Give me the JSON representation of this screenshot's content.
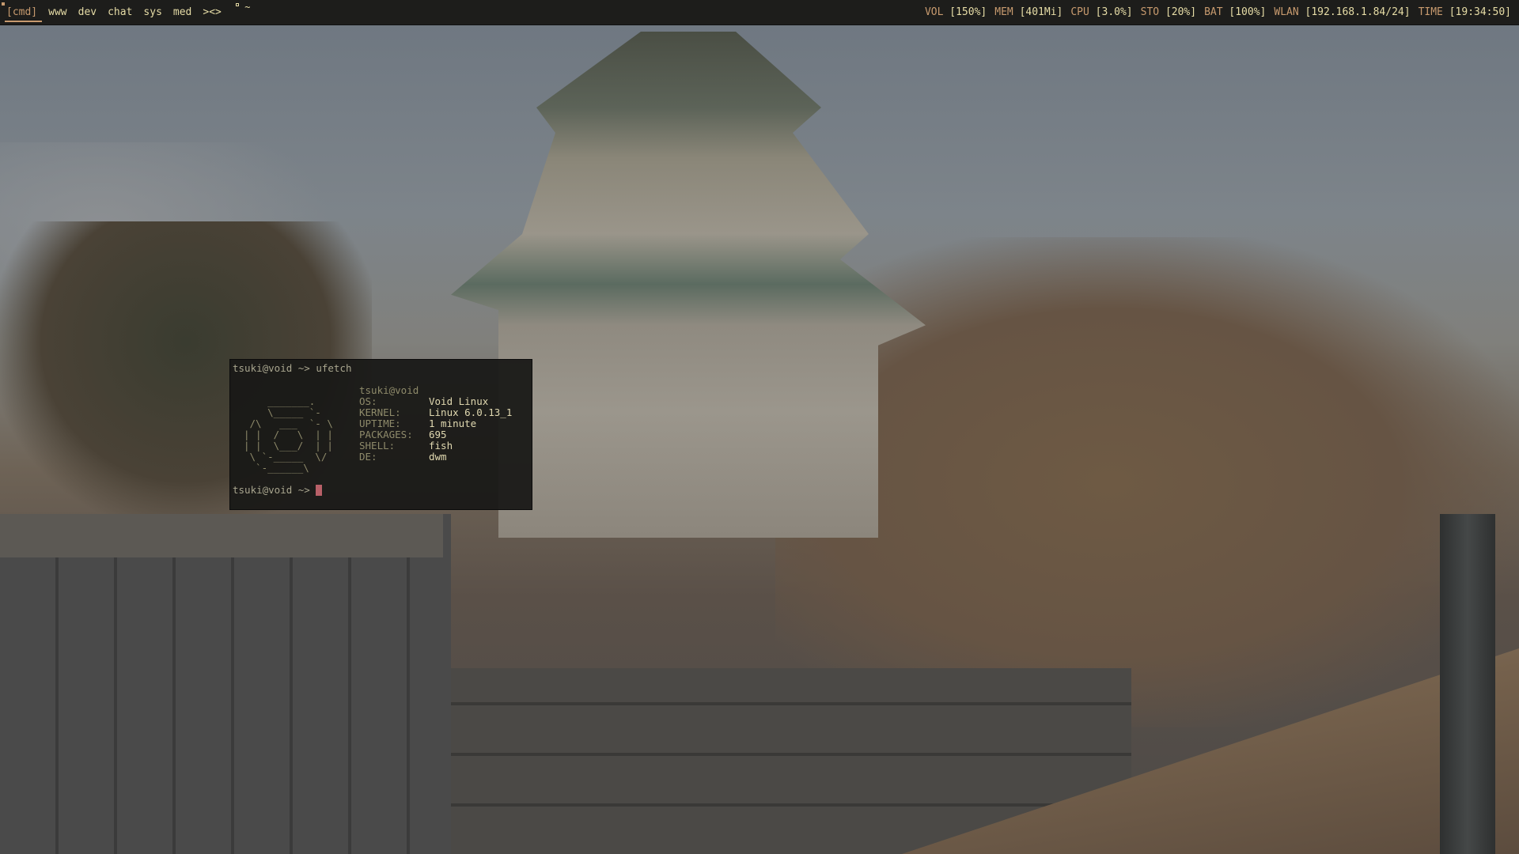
{
  "bar": {
    "tags": [
      {
        "label": "[cmd]",
        "selected": true
      },
      {
        "label": "www",
        "selected": false
      },
      {
        "label": "dev",
        "selected": false
      },
      {
        "label": "chat",
        "selected": false
      },
      {
        "label": "sys",
        "selected": false
      },
      {
        "label": "med",
        "selected": false
      }
    ],
    "layout": "><>",
    "window_title": "~",
    "status": [
      {
        "key": "VOL",
        "value": "[150%]"
      },
      {
        "key": "MEM",
        "value": "[401Mi]"
      },
      {
        "key": "CPU",
        "value": "[3.0%]"
      },
      {
        "key": "STO",
        "value": "[20%]"
      },
      {
        "key": "BAT",
        "value": "[100%]"
      },
      {
        "key": "WLAN",
        "value": "[192.168.1.84/24]"
      },
      {
        "key": "TIME",
        "value": "[19:34:50]"
      }
    ],
    "colors": {
      "background": "#1d1d1b",
      "text": "#e6dca6",
      "accent": "#c79a6e"
    }
  },
  "terminal": {
    "prompt": "tsuki@void ~> ",
    "command": "ufetch",
    "ascii_art": "    _______.\n    \\_____ `-\n /\\   ___  `- \\\n| |  /   \\  | |\n| |  \\___/  | |\n \\ `-_____  \\/\n  `-______\\",
    "header": "tsuki@void",
    "info": [
      {
        "label": "OS:",
        "value": "Void Linux"
      },
      {
        "label": "KERNEL:",
        "value": "Linux 6.0.13_1"
      },
      {
        "label": "UPTIME:",
        "value": "1 minute"
      },
      {
        "label": "PACKAGES:",
        "value": "695"
      },
      {
        "label": "SHELL:",
        "value": "fish"
      },
      {
        "label": "DE:",
        "value": "dwm"
      }
    ],
    "cursor_color": "#b86068"
  }
}
